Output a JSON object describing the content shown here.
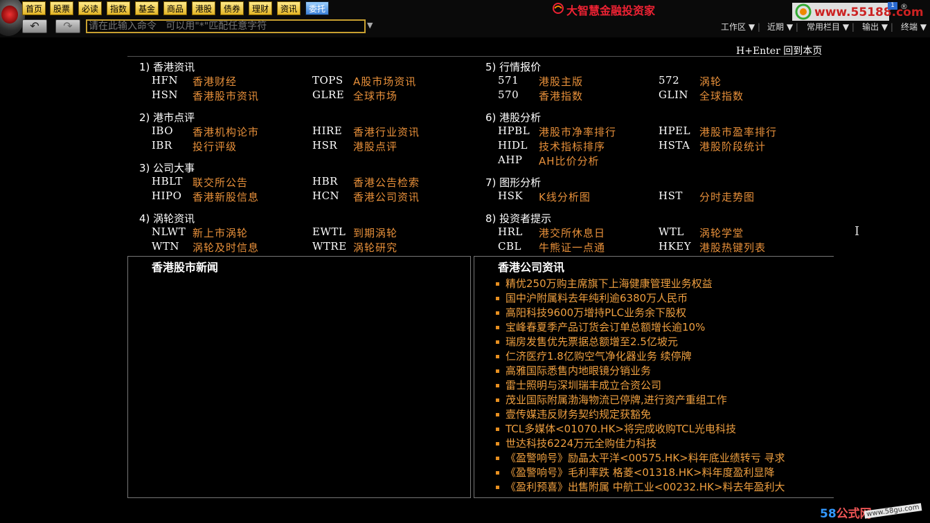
{
  "toolbar": {
    "nav": [
      "首页",
      "股票",
      "必读",
      "指数",
      "基金",
      "商品",
      "港股",
      "债券",
      "理财",
      "资讯",
      "委托"
    ],
    "selected_nav": "委托",
    "command_placeholder": "请在此输入命令   可以用\"*\"匹配任意字符",
    "brand": "大智慧金融投资家",
    "site_text": "www.55188.com",
    "badge": "1",
    "badge_r": "®",
    "menus": [
      "工作区",
      "近期",
      "常用栏目",
      "输出",
      "终端"
    ]
  },
  "page": {
    "return_hint": "H+Enter 回到本页"
  },
  "sections": [
    {
      "title": "1) 香港资讯",
      "items": [
        {
          "code": "HFN",
          "label": "香港财经"
        },
        {
          "code": "TOPS",
          "label": "A股市场资讯"
        },
        {
          "code": "HSN",
          "label": "香港股市资讯"
        },
        {
          "code": "GLRE",
          "label": "全球市场"
        }
      ]
    },
    {
      "title": "2) 港市点评",
      "items": [
        {
          "code": "IBO",
          "label": "香港机构论市"
        },
        {
          "code": "HIRE",
          "label": "香港行业资讯"
        },
        {
          "code": "IBR",
          "label": "投行评级"
        },
        {
          "code": "HSR",
          "label": "港股点评"
        }
      ]
    },
    {
      "title": "3) 公司大事",
      "items": [
        {
          "code": "HBLT",
          "label": "联交所公告"
        },
        {
          "code": "HBR",
          "label": "香港公告检索"
        },
        {
          "code": "HIPO",
          "label": "香港新股信息"
        },
        {
          "code": "HCN",
          "label": "香港公司资讯"
        }
      ]
    },
    {
      "title": "4) 涡轮资讯",
      "items": [
        {
          "code": "NLWT",
          "label": "新上市涡轮"
        },
        {
          "code": "EWTL",
          "label": "到期涡轮"
        },
        {
          "code": "WTN",
          "label": "涡轮及时信息"
        },
        {
          "code": "WTRE",
          "label": "涡轮研究"
        }
      ]
    },
    {
      "title": "5) 行情报价",
      "items": [
        {
          "code": "571",
          "label": "港股主版"
        },
        {
          "code": "572",
          "label": "涡轮"
        },
        {
          "code": "570",
          "label": "香港指数"
        },
        {
          "code": "GLIN",
          "label": "全球指数"
        }
      ]
    },
    {
      "title": "6) 港股分析",
      "items": [
        {
          "code": "HPBL",
          "label": "港股市净率排行"
        },
        {
          "code": "HPEL",
          "label": "港股市盈率排行"
        },
        {
          "code": "HIDL",
          "label": "技术指标排序"
        },
        {
          "code": "HSTA",
          "label": "港股阶段统计"
        },
        {
          "code": "AHP",
          "label": "AH比价分析"
        }
      ]
    },
    {
      "title": "7) 图形分析",
      "items": [
        {
          "code": "HSK",
          "label": "K线分析图"
        },
        {
          "code": "HST",
          "label": "分时走势图"
        }
      ]
    },
    {
      "title": "8) 投资者提示",
      "items": [
        {
          "code": "HRL",
          "label": "港交所休息日"
        },
        {
          "code": "WTL",
          "label": "涡轮学堂"
        },
        {
          "code": "CBL",
          "label": "牛熊证一点通"
        },
        {
          "code": "HKEY",
          "label": "港股热键列表"
        }
      ]
    }
  ],
  "panels": {
    "left_title": "香港股市新闻",
    "right_title": "香港公司资讯",
    "news": [
      "精优250万购主席旗下上海健康管理业务权益",
      "国中沪附属料去年纯利逾6380万人民币",
      "高阳科技9600万增持PLC业务余下股权",
      "宝峰春夏季产品订货会订单总额增长逾10%",
      "瑞房发售优先票据总额增至2.5亿坡元",
      "仁济医疗1.8亿购空气净化器业务  续停牌",
      "高雅国际悉售内地眼镜分销业务",
      "雷士照明与深圳瑞丰成立合资公司",
      "茂业国际附属渤海物流已停牌,进行资产重组工作",
      "壹传媒违反财务契约规定获豁免",
      "TCL多媒体<01070.HK>将完成收购TCL光电科技",
      "世达科技6224万元全购佳力科技",
      "《盈警响号》励晶太平洋<00575.HK>料年底业绩转亏   寻求",
      "《盈警响号》毛利率跌   格菱<01318.HK>料年度盈利显降",
      "《盈利预喜》出售附属   中航工业<00232.HK>料去年盈利大"
    ]
  },
  "footer": {
    "logo_num": "58",
    "logo_text": "公式网",
    "url": "www.58gu.com"
  }
}
